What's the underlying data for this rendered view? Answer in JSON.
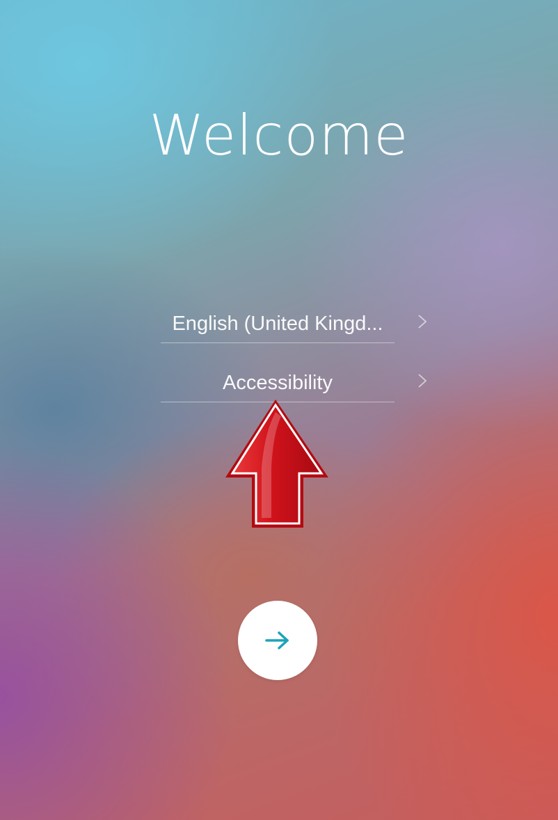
{
  "screen": {
    "title": "Welcome"
  },
  "options": [
    {
      "label": "English (United Kingd...",
      "icon": "chevron-right-icon"
    },
    {
      "label": "Accessibility",
      "icon": "chevron-right-icon"
    }
  ],
  "next_button": {
    "icon": "arrow-right-icon",
    "icon_color": "#1aa4b8"
  },
  "annotation": {
    "icon": "red-up-arrow",
    "color": "#d0121b"
  }
}
